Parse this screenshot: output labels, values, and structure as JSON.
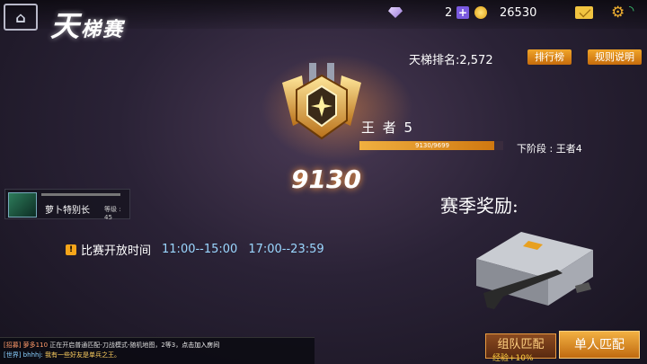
{
  "header": {
    "back_icon": "back-home-icon",
    "title_big": "天",
    "title_small": "梯赛",
    "diamonds": "2",
    "coins": "26530"
  },
  "rank": {
    "ranking_text": "天梯排名:2,572",
    "leaderboard_btn": "排行榜",
    "rules_btn": "规则说明",
    "tier_name": "王 者 5",
    "progress_text": "9130/9699",
    "progress_fraction": 0.94,
    "next_stage": "下阶段 : 王者4",
    "score": "9130"
  },
  "player": {
    "name": "萝卜特别长",
    "level": "等级 : 45"
  },
  "schedule": {
    "label": "比赛开放时间",
    "slot1": "11:00--15:00",
    "slot2": "17:00--23:59"
  },
  "reward": {
    "title": "赛季奖励:"
  },
  "chat": {
    "line1_tag": "[招募] 萝多110",
    "line1_text": "正在开启普通匹配-刀战模式-随机地图，2等3，",
    "line1_link": "点击加入房间",
    "line2_tag": "[世界] bhhhj:",
    "line2_text": "我有一些好友是单兵之王。"
  },
  "buttons": {
    "team_match": "组队匹配",
    "team_bonus": "经验+10%",
    "solo_match": "单人匹配"
  },
  "colors": {
    "accent": "#f0a52a",
    "time_blue": "#9bd7ff"
  }
}
